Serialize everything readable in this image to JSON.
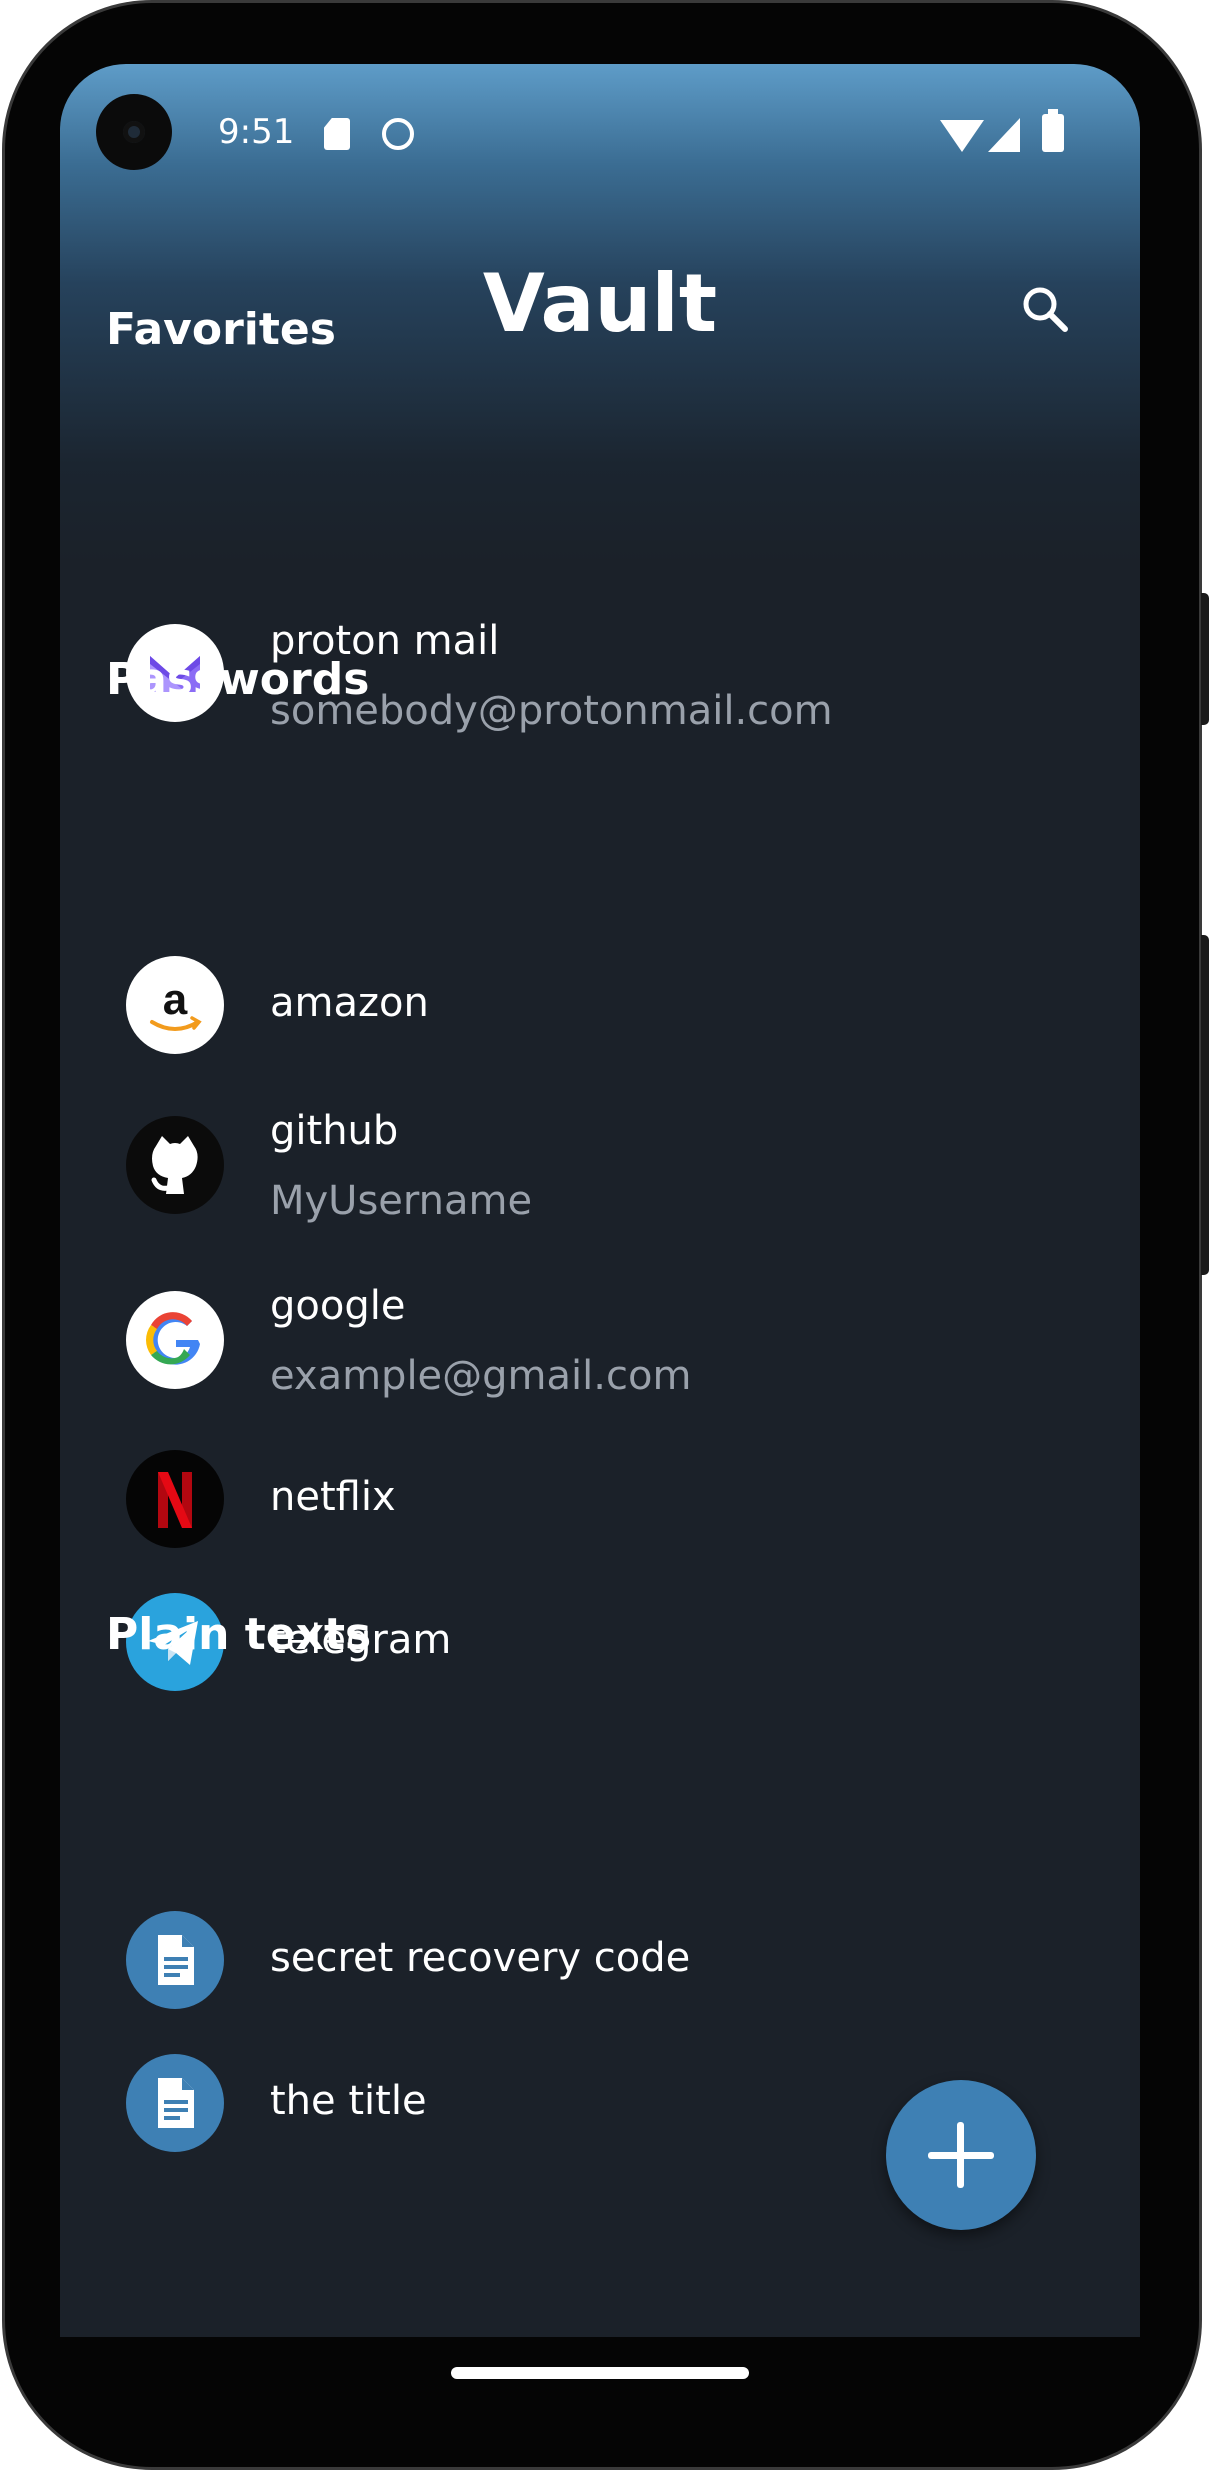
{
  "status_bar": {
    "time": "9:51"
  },
  "header": {
    "title": "Vault"
  },
  "sections": {
    "favorites": {
      "label": "Favorites",
      "items": [
        {
          "title": "proton mail",
          "subtitle": "somebody@protonmail.com",
          "icon": "proton-mail-icon"
        }
      ]
    },
    "passwords": {
      "label": "Passwords",
      "items": [
        {
          "title": "amazon",
          "icon": "amazon-icon"
        },
        {
          "title": "github",
          "subtitle": "MyUsername",
          "icon": "github-icon"
        },
        {
          "title": "google",
          "subtitle": "example@gmail.com",
          "icon": "google-icon"
        },
        {
          "title": "netflix",
          "icon": "netflix-icon"
        },
        {
          "title": "telegram",
          "icon": "telegram-icon"
        }
      ]
    },
    "plain_texts": {
      "label": "Plain texts",
      "items": [
        {
          "title": "secret recovery code",
          "icon": "document-icon"
        },
        {
          "title": "the title",
          "icon": "document-icon"
        }
      ]
    }
  },
  "colors": {
    "background": "#1b2129",
    "accent": "#3e80b4",
    "header_gradient_top": "#5e9cc8",
    "subtitle": "#9aa1ab"
  }
}
